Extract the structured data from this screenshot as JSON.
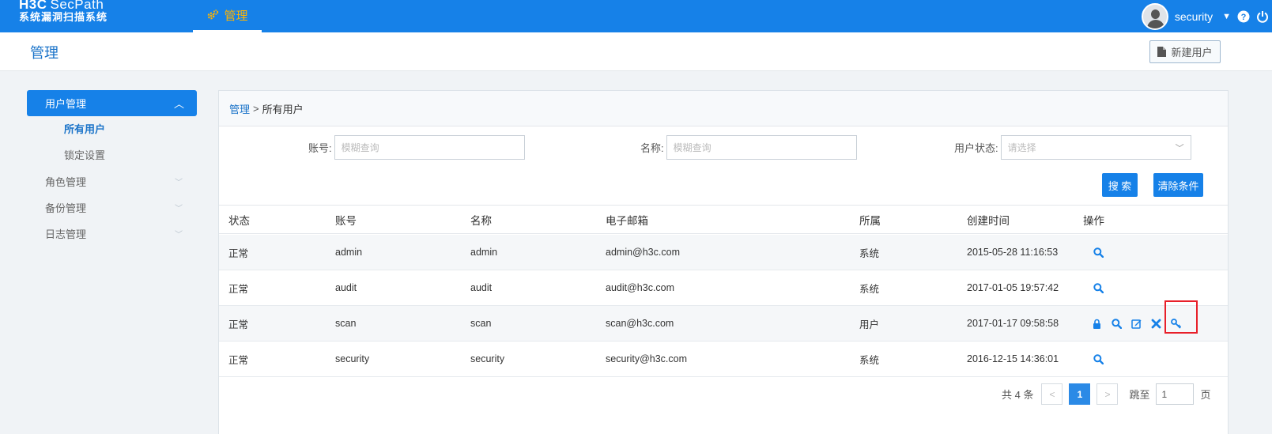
{
  "app": {
    "logo_line1": "H3C",
    "logo_line1b": "SecPath",
    "logo_line2": "系统漏洞扫描系统",
    "nav_label": "管理",
    "username": "security"
  },
  "subheader": {
    "title": "管理",
    "new_user_label": "新建用户"
  },
  "sidebar": {
    "group_active": "用户管理",
    "sub_items": [
      "所有用户",
      "锁定设置"
    ],
    "items": [
      "角色管理",
      "备份管理",
      "日志管理"
    ]
  },
  "breadcrumb": {
    "root": "管理",
    "sep": ">",
    "current": "所有用户"
  },
  "filters": {
    "account_label": "账号:",
    "account_placeholder": "模糊查询",
    "name_label": "名称:",
    "name_placeholder": "模糊查询",
    "status_label": "用户状态:",
    "status_placeholder": "请选择",
    "search_label": "搜 索",
    "clear_label": "清除条件"
  },
  "table": {
    "headers": [
      "状态",
      "账号",
      "名称",
      "电子邮箱",
      "所属",
      "创建时间",
      "操作"
    ],
    "rows": [
      {
        "status": "正常",
        "account": "admin",
        "name": "admin",
        "email": "admin@h3c.com",
        "belong": "系统",
        "created": "2015-05-28 11:16:53"
      },
      {
        "status": "正常",
        "account": "audit",
        "name": "audit",
        "email": "audit@h3c.com",
        "belong": "系统",
        "created": "2017-01-05 19:57:42"
      },
      {
        "status": "正常",
        "account": "scan",
        "name": "scan",
        "email": "scan@h3c.com",
        "belong": "用户",
        "created": "2017-01-17 09:58:58"
      },
      {
        "status": "正常",
        "account": "security",
        "name": "security",
        "email": "security@h3c.com",
        "belong": "系统",
        "created": "2016-12-15 14:36:01"
      }
    ]
  },
  "pager": {
    "total": "共 4 条",
    "current_page": "1",
    "goto_label": "跳至",
    "goto_value": "1",
    "page_suffix": "页"
  },
  "colors": {
    "primary": "#1681e8",
    "nav_accent": "#ffb400",
    "highlight": "#e8202a"
  }
}
